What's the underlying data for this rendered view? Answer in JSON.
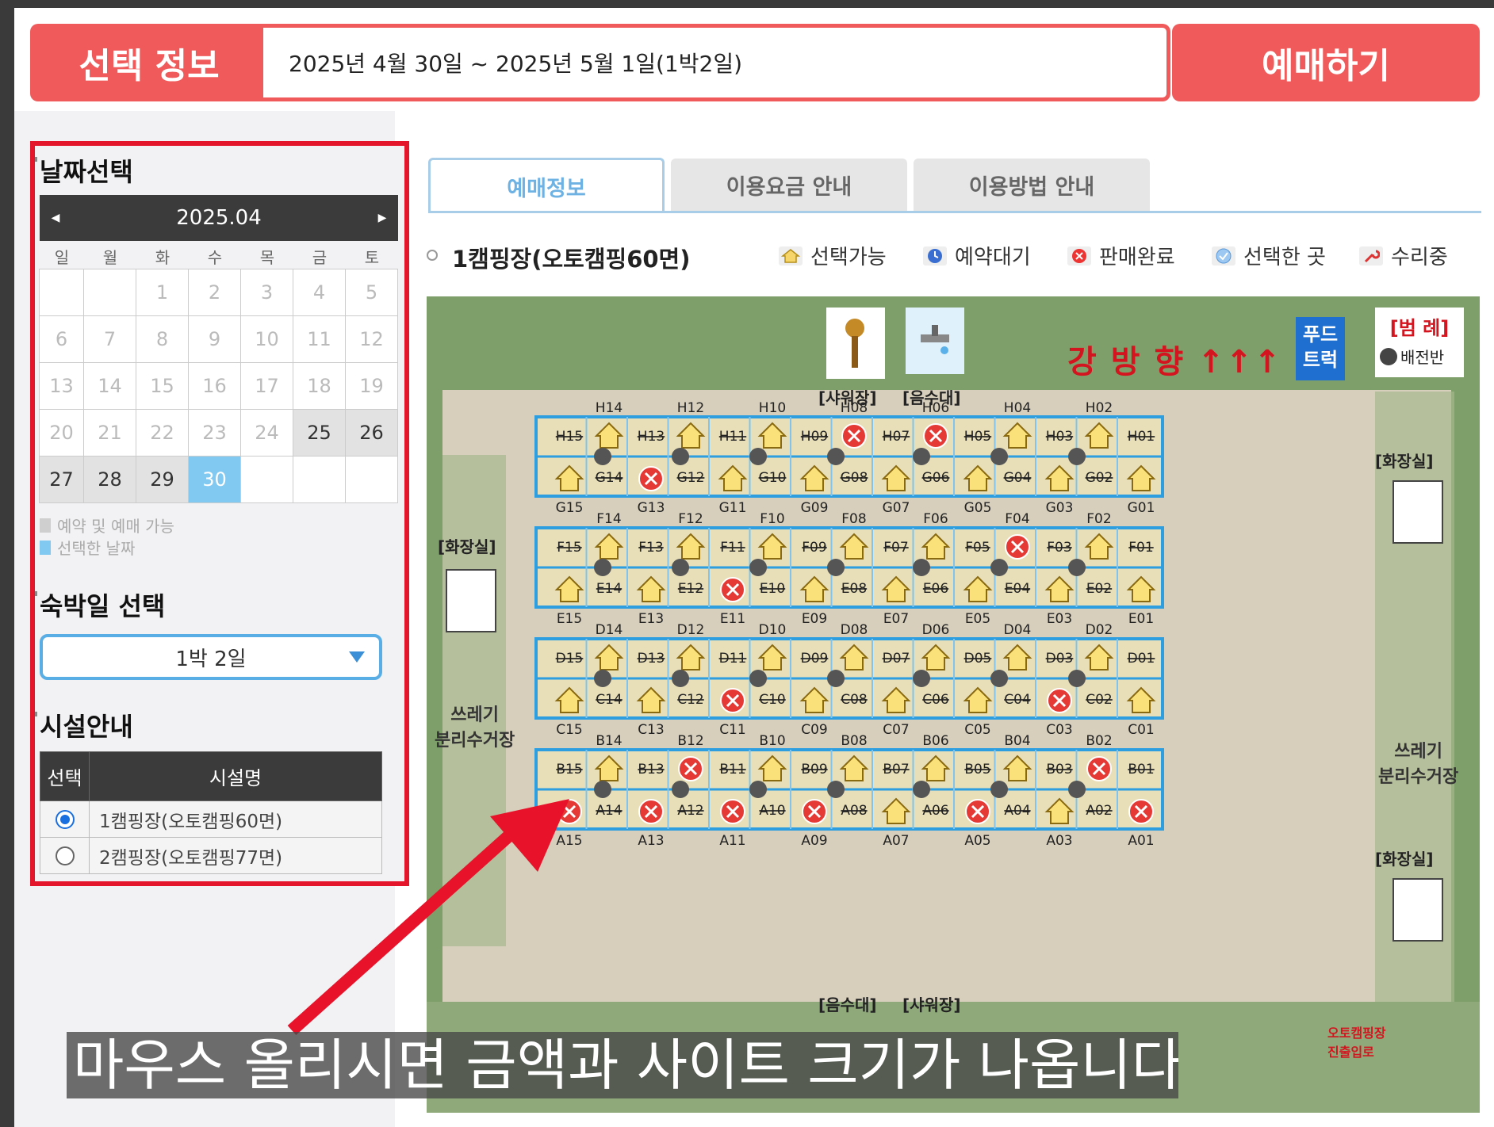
{
  "header": {
    "label": "선택 정보",
    "date_range": "2025년 4월 30일 ~ 2025년 5월 1일(1박2일)",
    "book_button": "예매하기"
  },
  "left": {
    "date_title": "날짜선택",
    "calendar": {
      "month": "2025.04",
      "weekdays": [
        "일",
        "월",
        "화",
        "수",
        "목",
        "금",
        "토"
      ],
      "weeks": [
        [
          {
            "d": "",
            "s": "empty"
          },
          {
            "d": "",
            "s": "empty"
          },
          {
            "d": "1",
            "s": "off"
          },
          {
            "d": "2",
            "s": "off"
          },
          {
            "d": "3",
            "s": "off"
          },
          {
            "d": "4",
            "s": "off"
          },
          {
            "d": "5",
            "s": "off"
          }
        ],
        [
          {
            "d": "6",
            "s": "off"
          },
          {
            "d": "7",
            "s": "off"
          },
          {
            "d": "8",
            "s": "off"
          },
          {
            "d": "9",
            "s": "off"
          },
          {
            "d": "10",
            "s": "off"
          },
          {
            "d": "11",
            "s": "off"
          },
          {
            "d": "12",
            "s": "off"
          }
        ],
        [
          {
            "d": "13",
            "s": "off"
          },
          {
            "d": "14",
            "s": "off"
          },
          {
            "d": "15",
            "s": "off"
          },
          {
            "d": "16",
            "s": "off"
          },
          {
            "d": "17",
            "s": "off"
          },
          {
            "d": "18",
            "s": "off"
          },
          {
            "d": "19",
            "s": "off"
          }
        ],
        [
          {
            "d": "20",
            "s": "off"
          },
          {
            "d": "21",
            "s": "off"
          },
          {
            "d": "22",
            "s": "off"
          },
          {
            "d": "23",
            "s": "off"
          },
          {
            "d": "24",
            "s": "off"
          },
          {
            "d": "25",
            "s": "avail"
          },
          {
            "d": "26",
            "s": "avail"
          }
        ],
        [
          {
            "d": "27",
            "s": "avail"
          },
          {
            "d": "28",
            "s": "avail"
          },
          {
            "d": "29",
            "s": "avail"
          },
          {
            "d": "30",
            "s": "sel"
          },
          {
            "d": "",
            "s": "empty"
          },
          {
            "d": "",
            "s": "empty"
          },
          {
            "d": "",
            "s": "empty"
          }
        ]
      ],
      "legend_available": "예약 및 예매 가능",
      "legend_selected": "선택한 날짜",
      "legend_available_color": "#cfcfcf",
      "legend_selected_color": "#82c9f2"
    },
    "nights_title": "숙박일 선택",
    "nights_value": "1박 2일",
    "facility_title": "시설안내",
    "facility_headers": [
      "선택",
      "시설명"
    ],
    "facilities": [
      {
        "name": "1캠핑장(오토캠핑60면)",
        "checked": true
      },
      {
        "name": "2캠핑장(오토캠핑77면)",
        "checked": false
      }
    ]
  },
  "tabs": [
    "예매정보",
    "이용요금 안내",
    "이용방법 안내"
  ],
  "camp": {
    "title": "1캠핑장(오토캠핑60면)",
    "legend": [
      {
        "label": "선택가능",
        "icon": "house-icon"
      },
      {
        "label": "예약대기",
        "icon": "clock-icon"
      },
      {
        "label": "판매완료",
        "icon": "x-circle-icon"
      },
      {
        "label": "선택한 곳",
        "icon": "check-icon"
      },
      {
        "label": "수리중",
        "icon": "wrench-icon"
      }
    ]
  },
  "map": {
    "shower_label": "[샤워장]",
    "water_label": "[음수대]",
    "river_text": "강 방 향 ↑↑↑",
    "food_truck": "푸드\n트럭",
    "legend_title": "[범 례]",
    "legend_item": "배전반",
    "toilet_label": "[화장실]",
    "trash_label": "쓰레기\n분리수거장",
    "water_label_bottom": "[음수대]",
    "shower_label_bottom": "[샤워장]",
    "entrance_label": "오토캠핑장\n진출입로",
    "rows": [
      {
        "top_labels": [
          "H14",
          "H12",
          "H10",
          "H08",
          "H06",
          "H04",
          "H02"
        ],
        "top_strike": [
          "H15",
          "H13",
          "H11",
          "H09",
          "H07",
          "H05",
          "H03",
          "H01"
        ],
        "top_states": [
          "avail",
          "avail",
          "avail",
          "sold",
          "sold",
          "avail",
          "avail"
        ],
        "bottom_labels": [
          "G15",
          "G13",
          "G11",
          "G09",
          "G07",
          "G05",
          "G03",
          "G01"
        ],
        "bottom_strike": [
          "G14",
          "G12",
          "G10",
          "G08",
          "G06",
          "G04",
          "G02"
        ],
        "bottom_states": [
          "avail",
          "sold",
          "avail",
          "avail",
          "avail",
          "avail",
          "avail",
          "avail"
        ]
      },
      {
        "top_labels": [
          "F14",
          "F12",
          "F10",
          "F08",
          "F06",
          "F04",
          "F02"
        ],
        "top_strike": [
          "F15",
          "F13",
          "F11",
          "F09",
          "F07",
          "F05",
          "F03",
          "F01"
        ],
        "top_states": [
          "avail",
          "avail",
          "avail",
          "avail",
          "avail",
          "sold",
          "avail"
        ],
        "bottom_labels": [
          "E15",
          "E13",
          "E11",
          "E09",
          "E07",
          "E05",
          "E03",
          "E01"
        ],
        "bottom_strike": [
          "E14",
          "E12",
          "E10",
          "E08",
          "E06",
          "E04",
          "E02"
        ],
        "bottom_states": [
          "avail",
          "avail",
          "sold",
          "avail",
          "avail",
          "avail",
          "avail",
          "avail"
        ]
      },
      {
        "top_labels": [
          "D14",
          "D12",
          "D10",
          "D08",
          "D06",
          "D04",
          "D02"
        ],
        "top_strike": [
          "D15",
          "D13",
          "D11",
          "D09",
          "D07",
          "D05",
          "D03",
          "D01"
        ],
        "top_states": [
          "avail",
          "avail",
          "avail",
          "avail",
          "avail",
          "avail",
          "avail"
        ],
        "bottom_labels": [
          "C15",
          "C13",
          "C11",
          "C09",
          "C07",
          "C05",
          "C03",
          "C01"
        ],
        "bottom_strike": [
          "C14",
          "C12",
          "C10",
          "C08",
          "C06",
          "C04",
          "C02"
        ],
        "bottom_states": [
          "avail",
          "avail",
          "sold",
          "avail",
          "avail",
          "avail",
          "sold",
          "avail"
        ]
      },
      {
        "top_labels": [
          "B14",
          "B12",
          "B10",
          "B08",
          "B06",
          "B04",
          "B02"
        ],
        "top_strike": [
          "B15",
          "B13",
          "B11",
          "B09",
          "B07",
          "B05",
          "B03",
          "B01"
        ],
        "top_states": [
          "avail",
          "sold",
          "avail",
          "avail",
          "avail",
          "avail",
          "sold"
        ],
        "bottom_labels": [
          "A15",
          "A13",
          "A11",
          "A09",
          "A07",
          "A05",
          "A03",
          "A01"
        ],
        "bottom_strike": [
          "A14",
          "A12",
          "A10",
          "A08",
          "A06",
          "A04",
          "A02"
        ],
        "bottom_states": [
          "sold",
          "sold",
          "sold",
          "sold",
          "avail",
          "sold",
          "avail",
          "sold"
        ]
      }
    ]
  },
  "caption": "마우스 올리시면 금액과 사이트 크기가 나옵니다",
  "colors": {
    "accent": "#f15a5a",
    "highlight": "#e3162c",
    "tab_active": "#6eb2e4"
  }
}
